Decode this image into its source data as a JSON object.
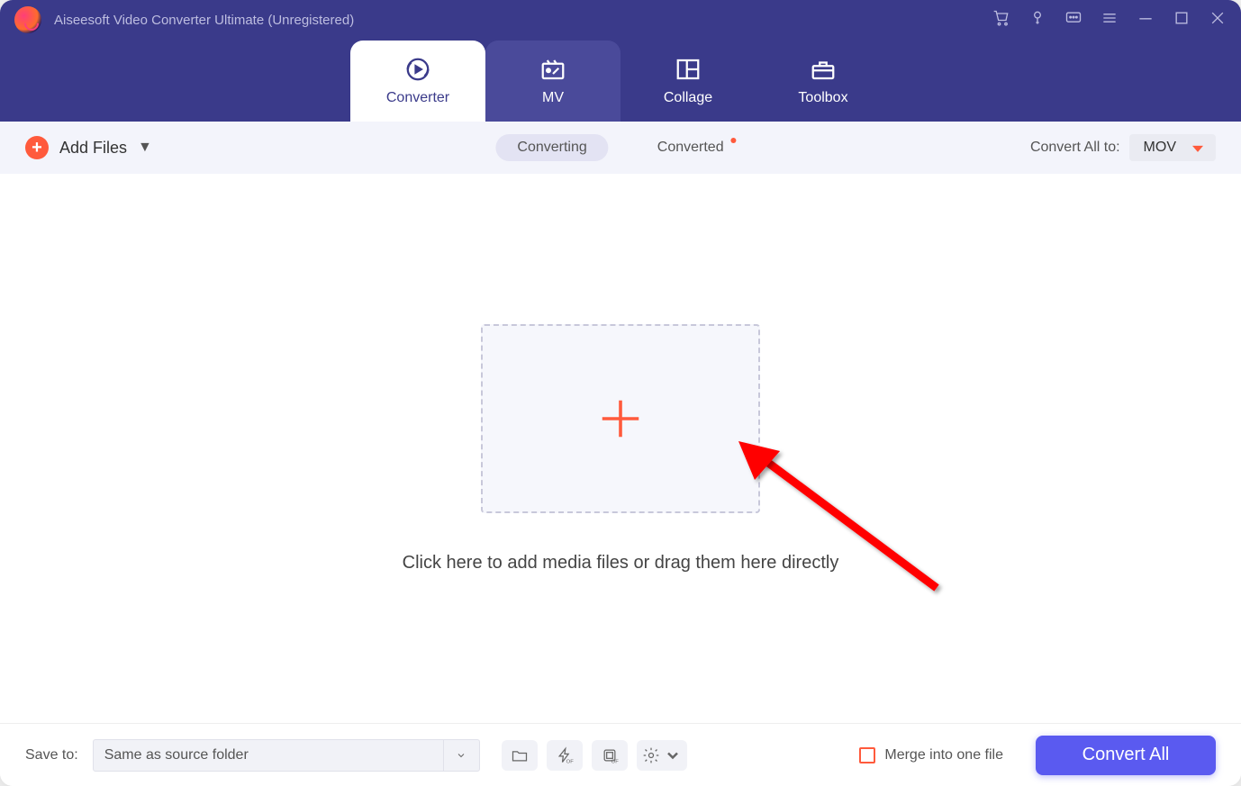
{
  "window": {
    "title": "Aiseesoft Video Converter Ultimate (Unregistered)"
  },
  "tabs": {
    "converter": "Converter",
    "mv": "MV",
    "collage": "Collage",
    "toolbox": "Toolbox"
  },
  "toolbar": {
    "add_files": "Add Files",
    "converting": "Converting",
    "converted": "Converted",
    "convert_all_to": "Convert All to:",
    "selected_format": "MOV"
  },
  "dropzone": {
    "hint": "Click here to add media files or drag them here directly"
  },
  "footer": {
    "save_to_label": "Save to:",
    "save_to_value": "Same as source folder",
    "merge_label": "Merge into one file",
    "convert_button": "Convert All"
  }
}
